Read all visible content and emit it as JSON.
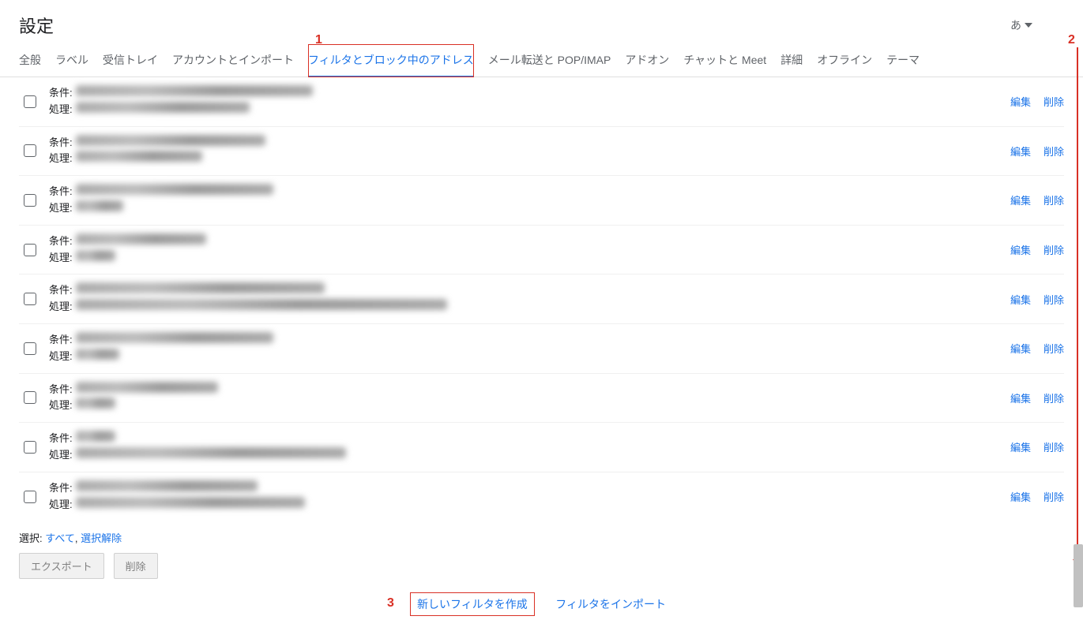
{
  "header": {
    "title": "設定",
    "lang": "あ"
  },
  "tabs": [
    {
      "label": "全般",
      "active": false
    },
    {
      "label": "ラベル",
      "active": false
    },
    {
      "label": "受信トレイ",
      "active": false
    },
    {
      "label": "アカウントとインポート",
      "active": false
    },
    {
      "label": "フィルタとブロック中のアドレス",
      "active": true,
      "highlighted": true
    },
    {
      "label": "メール転送と POP/IMAP",
      "active": false
    },
    {
      "label": "アドオン",
      "active": false
    },
    {
      "label": "チャットと Meet",
      "active": false
    },
    {
      "label": "詳細",
      "active": false
    },
    {
      "label": "オフライン",
      "active": false
    },
    {
      "label": "テーマ",
      "active": false
    }
  ],
  "filters": {
    "condition_label": "条件:",
    "action_label": "処理:",
    "edit_label": "編集",
    "delete_label": "削除",
    "rows": [
      {
        "cond_width": 300,
        "action_width": 220
      },
      {
        "cond_width": 240,
        "action_width": 160
      },
      {
        "cond_width": 250,
        "action_width": 60
      },
      {
        "cond_width": 165,
        "action_width": 50
      },
      {
        "cond_width": 315,
        "action_width": 470
      },
      {
        "cond_width": 250,
        "action_width": 55
      },
      {
        "cond_width": 180,
        "action_width": 50
      },
      {
        "cond_width": 50,
        "action_width": 342
      },
      {
        "cond_width": 230,
        "action_width": 290
      }
    ]
  },
  "footer": {
    "select_label": "選択:",
    "select_all": "すべて",
    "select_none": "選択解除",
    "export_btn": "エクスポート",
    "delete_btn": "削除",
    "create_filter": "新しいフィルタを作成",
    "import_filter": "フィルタをインポート"
  },
  "callouts": {
    "c1": "1",
    "c2": "2",
    "c3": "3"
  }
}
